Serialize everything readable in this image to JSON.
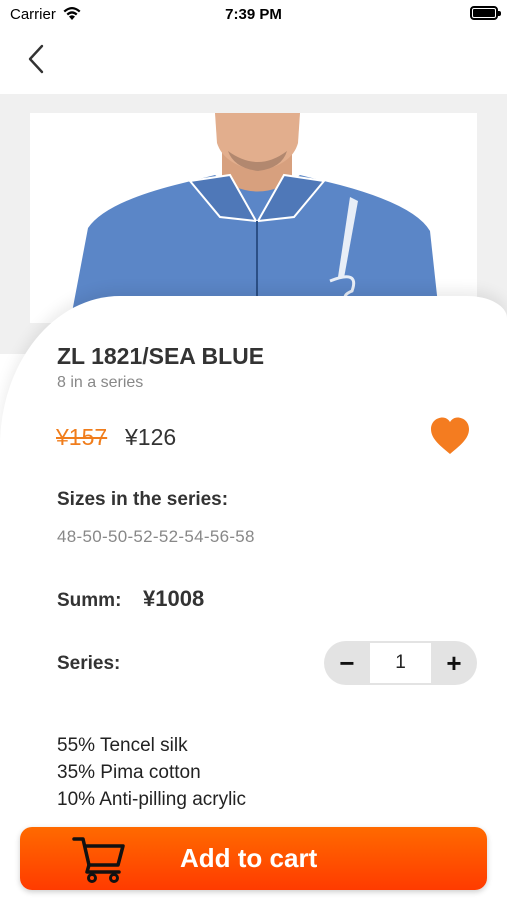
{
  "status_bar": {
    "carrier": "Carrier",
    "time": "7:39 PM",
    "wifi_icon": "wifi-icon",
    "battery_icon": "battery-icon"
  },
  "nav": {
    "back_icon": "chevron-left-icon"
  },
  "product": {
    "title": "ZL 1821/SEA BLUE",
    "series_count": "8 in a series",
    "old_price": "¥157",
    "new_price": "¥126",
    "favorite_icon": "heart-icon",
    "sizes_label": "Sizes in the series:",
    "sizes_value": "48-50-50-52-52-54-56-58",
    "summ_label": "Summ:",
    "summ_value": "¥1008",
    "series_label": "Series:",
    "quantity": "1",
    "minus_label": "−",
    "plus_label": "+",
    "composition": [
      "55% Tencel silk",
      "35% Pima cotton",
      "10% Anti-pilling acrylic"
    ]
  },
  "cart_button": {
    "label": "Add to cart",
    "icon": "cart-icon"
  },
  "colors": {
    "accent": "#ff5a00",
    "old_price": "#f07d1c",
    "heart": "#f47c20",
    "shirt": "#5b86c7"
  }
}
